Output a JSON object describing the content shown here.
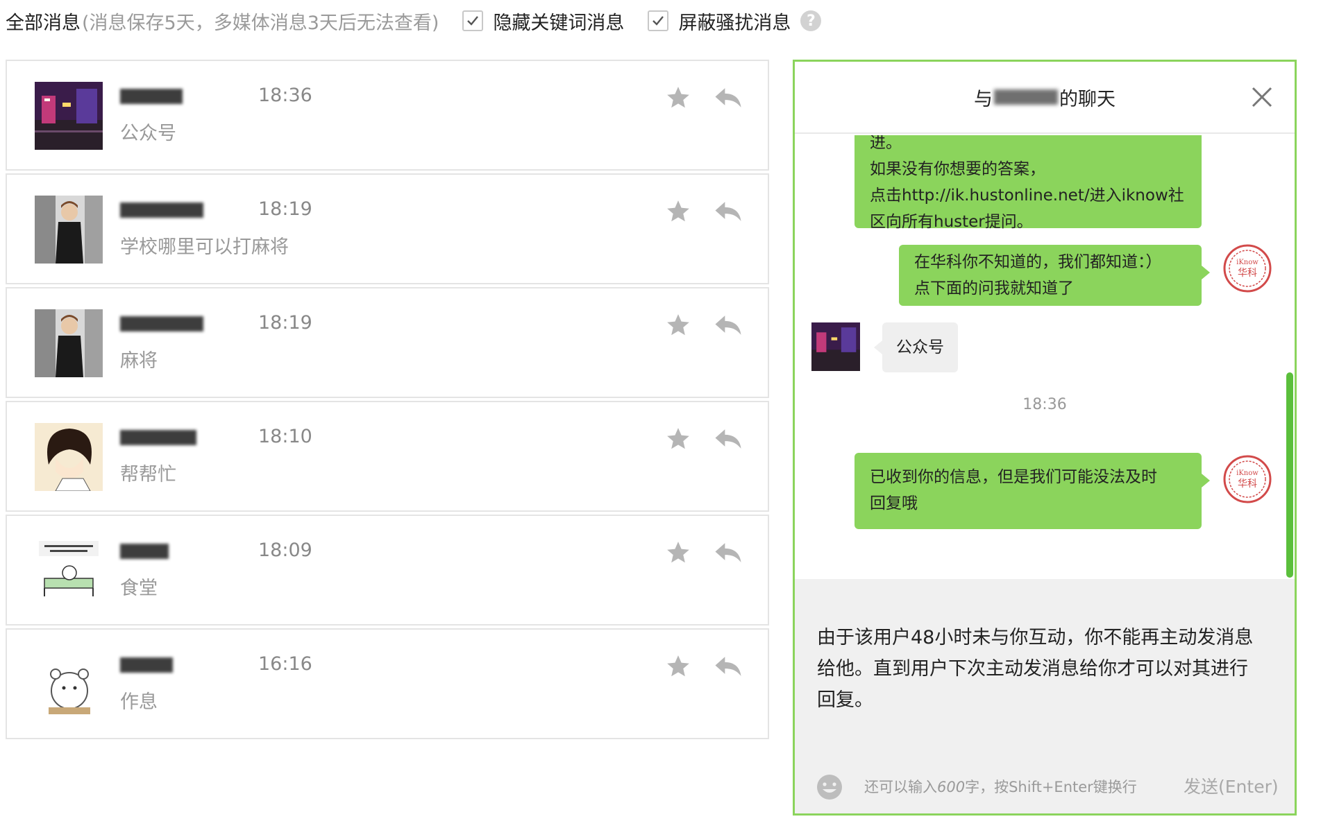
{
  "filter_bar": {
    "title": "全部消息",
    "note": "(消息保存5天，多媒体消息3天后无法查看)",
    "options": [
      {
        "label": "隐藏关键词消息",
        "checked": true
      },
      {
        "label": "屏蔽骚扰消息",
        "checked": true
      }
    ],
    "help_icon": "question-circle-icon"
  },
  "messages": [
    {
      "time": "18:36",
      "preview": "公众号",
      "avatar": "night-street-avatar"
    },
    {
      "time": "18:19",
      "preview": "学校哪里可以打麻将",
      "avatar": "man-in-jacket-avatar"
    },
    {
      "time": "18:19",
      "preview": "麻将",
      "avatar": "man-in-jacket-avatar"
    },
    {
      "time": "18:10",
      "preview": "帮帮忙",
      "avatar": "cartoon-girl-avatar"
    },
    {
      "time": "18:09",
      "preview": "食堂",
      "avatar": "sticker-bed-avatar"
    },
    {
      "time": "16:16",
      "preview": "作息",
      "avatar": "cartoon-bear-avatar"
    }
  ],
  "chat": {
    "title_prefix": "与",
    "title_suffix": "的聊天",
    "bubble1_lines": [
      "进。",
      "如果没有你想要的答案，",
      "点击http://ik.hustonline.net/进入iknow社",
      "区向所有huster提问。"
    ],
    "bubble2_lines": [
      "在华科你不知道的，我们都知道：）",
      "点下面的问我就知道了"
    ],
    "left_bubble": "公众号",
    "timestamp": "18:36",
    "bubble3_lines": [
      "已收到你的信息，但是我们可能没法及时",
      "回复哦"
    ],
    "stamp_text_top": "iKnow",
    "stamp_text_main": "华科",
    "notice_lines": [
      "由于该用户48小时未与你互动，你不能再主动发消息",
      "给他。直到用户下次主动发消息给你才可以对其进行",
      "回复。"
    ],
    "char_hint_prefix": "还可以输入",
    "char_hint_count": "600",
    "char_hint_suffix": "字，按Shift+Enter键换行",
    "send_label": "发送(Enter)"
  },
  "colors": {
    "accent_green": "#8bd45c",
    "scrollbar_green": "#5bbf3c",
    "muted_text": "#999999"
  }
}
